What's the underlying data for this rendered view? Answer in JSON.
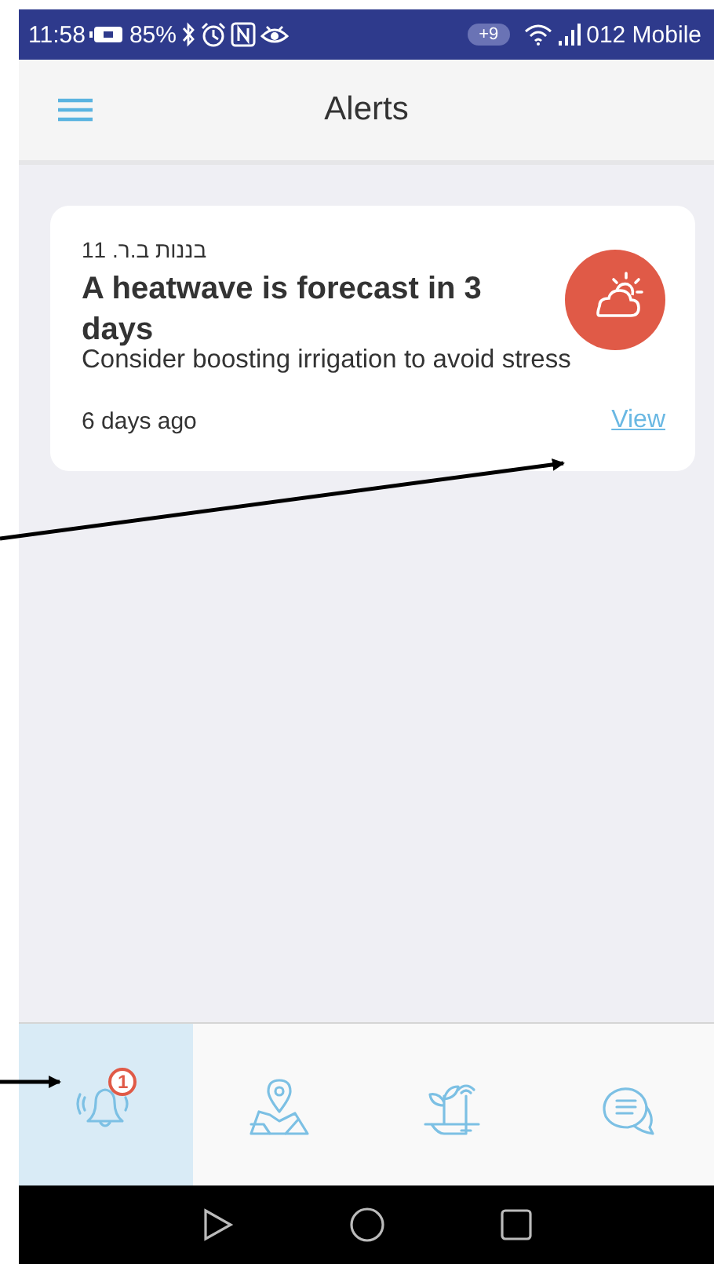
{
  "status_bar": {
    "time": "11:58",
    "battery": "85%",
    "notification_count": "+9",
    "carrier": "012 Mobile"
  },
  "header": {
    "title": "Alerts"
  },
  "alerts": [
    {
      "location": "בננות ב.ר. 11",
      "title": "A heatwave is forecast in 3 days",
      "message": "Consider boosting irrigation to avoid stress",
      "age": "6 days ago",
      "action": "View",
      "kind": "weather"
    }
  ],
  "nav_tabs": [
    {
      "kind": "alerts",
      "selected": true,
      "badge": "1"
    },
    {
      "kind": "map",
      "selected": false
    },
    {
      "kind": "sensors",
      "selected": false
    },
    {
      "kind": "chat",
      "selected": false
    }
  ]
}
